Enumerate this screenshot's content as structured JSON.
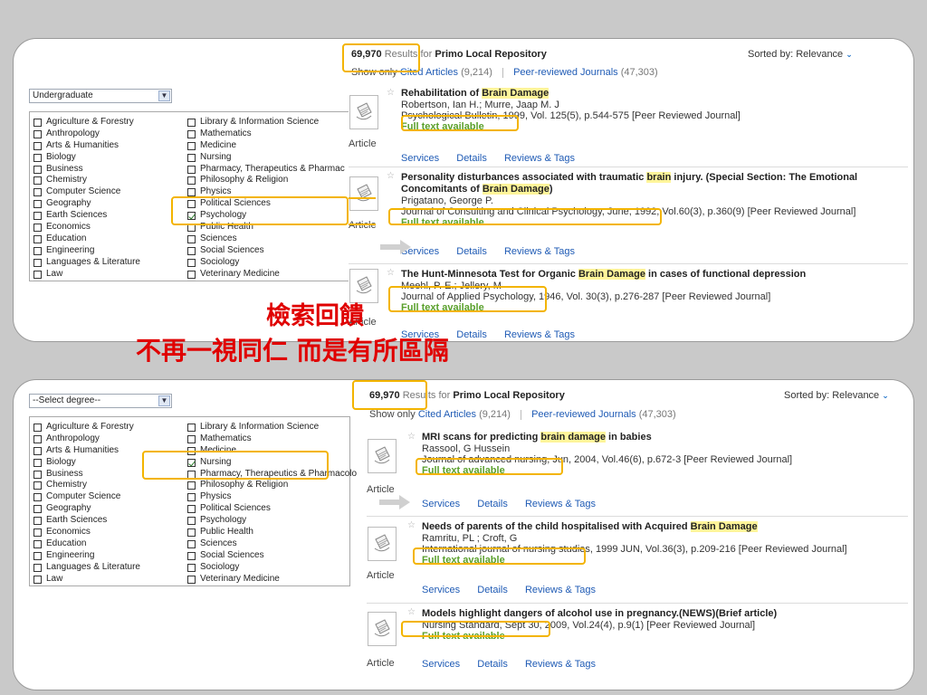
{
  "top_panel": {
    "degree": "Undergraduate",
    "subjects_left": [
      "Agriculture & Forestry",
      "Anthropology",
      "Arts & Humanities",
      "Biology",
      "Business",
      "Chemistry",
      "Computer Science",
      "Geography",
      "Earth Sciences",
      "Economics",
      "Education",
      "Engineering",
      "Languages & Literature",
      "Law"
    ],
    "subjects_right": [
      "Library & Information Science",
      "Mathematics",
      "Medicine",
      "Nursing",
      "Pharmacy, Therapeutics & Pharmac",
      "Philosophy & Religion",
      "Physics",
      "Political Sciences",
      "Psychology",
      "Public Health",
      "Sciences",
      "Social Sciences",
      "Sociology",
      "Veterinary Medicine"
    ],
    "checked_subject": "Psychology",
    "results_count": "69,970",
    "results_text": "Results for",
    "repository": "Primo Local Repository",
    "sorted_label": "Sorted by:",
    "sorted_value": "Relevance",
    "show_only": "Show only",
    "cited_articles": "Cited Articles",
    "cited_count": "(9,214)",
    "peer_reviewed": "Peer-reviewed Journals",
    "peer_count": "(47,303)",
    "records": [
      {
        "title_pre": "Rehabilitation of ",
        "title_hl": "Brain Damage",
        "title_post": "",
        "authors": "Robertson, Ian H.; Murre, Jaap M. J",
        "source": "Psychological Bulletin, 1999, Vol. 125(5), p.544-575 [Peer Reviewed Journal]",
        "fulltext": "Full text available",
        "type": "Article"
      },
      {
        "title_pre": "Personality disturbances associated with traumatic ",
        "title_hl": "brain",
        "title_post": " injury. (Special Section: The Emotional",
        "title_line2_pre": "Concomitants of ",
        "title_line2_hl": "Brain Damage",
        "title_line2_post": ")",
        "authors": "Prigatano, George P.",
        "source": "Journal of Consulting and Clinical Psychology, June, 1992, Vol.60(3), p.360(9) [Peer Reviewed Journal]",
        "fulltext": "Full text available",
        "type": "Article"
      },
      {
        "title_pre": "The Hunt-Minnesota Test for Organic ",
        "title_hl": "Brain Damage",
        "title_post": " in cases of functional depression",
        "authors": "Meehl, P. E.; Jellery, M",
        "source": "Journal of Applied Psychology, 1946, Vol. 30(3), p.276-287 [Peer Reviewed Journal]",
        "fulltext": "Full text available",
        "type": "Article"
      }
    ],
    "links": [
      "Services",
      "Details",
      "Reviews & Tags"
    ]
  },
  "bottom_panel": {
    "degree": "--Select degree--",
    "subjects_left": [
      "Agriculture & Forestry",
      "Anthropology",
      "Arts & Humanities",
      "Biology",
      "Business",
      "Chemistry",
      "Computer Science",
      "Geography",
      "Earth Sciences",
      "Economics",
      "Education",
      "Engineering",
      "Languages & Literature",
      "Law"
    ],
    "subjects_right": [
      "Library & Information Science",
      "Mathematics",
      "Medicine",
      "Nursing",
      "Pharmacy, Therapeutics & Pharmacolo",
      "Philosophy & Religion",
      "Physics",
      "Political Sciences",
      "Psychology",
      "Public Health",
      "Sciences",
      "Social Sciences",
      "Sociology",
      "Veterinary Medicine"
    ],
    "checked_subject": "Nursing",
    "results_count": "69,970",
    "results_text": "Results for",
    "repository": "Primo Local Repository",
    "sorted_label": "Sorted by:",
    "sorted_value": "Relevance",
    "show_only": "Show only",
    "cited_articles": "Cited Articles",
    "cited_count": "(9,214)",
    "peer_reviewed": "Peer-reviewed Journals",
    "peer_count": "(47,303)",
    "records": [
      {
        "title_pre": "MRI scans for predicting ",
        "title_hl": "brain damage",
        "title_post": " in babies",
        "authors": "Rassool, G Hussein",
        "source": "Journal of advanced nursing, Jun, 2004, Vol.46(6), p.672-3 [Peer Reviewed Journal]",
        "fulltext": "Full text available",
        "type": "Article"
      },
      {
        "title_pre": "Needs of parents of the child hospitalised with Acquired ",
        "title_hl": "Brain Damage",
        "title_post": "",
        "authors": "Ramritu, PL ; Croft, G",
        "source": "International journal of nursing studies, 1999 JUN, Vol.36(3), p.209-216 [Peer Reviewed Journal]",
        "fulltext": "Full text available",
        "type": "Article"
      },
      {
        "title_pre": "Models highlight dangers of alcohol use in pregnancy.(NEWS)(Brief article)",
        "title_hl": "",
        "title_post": "",
        "authors": "",
        "source": "Nursing Standard, Sept 30, 2009, Vol.24(4), p.9(1) [Peer Reviewed Journal]",
        "fulltext": "Full text available",
        "type": "Article"
      }
    ],
    "links": [
      "Services",
      "Details",
      "Reviews & Tags"
    ]
  },
  "annotation": {
    "line1": "檢索回饋",
    "line2": "不再一視同仁 而是有所區隔",
    "color": "#e00000"
  },
  "colors": {
    "highlight_box": "#f3b400",
    "fulltext": "#5aa02c",
    "link": "#1f5bb5",
    "keyword_bg": "#fff59a"
  },
  "icons": {
    "document": "document-icon",
    "star": "star-icon",
    "checkbox": "checkbox-icon",
    "arrow": "gray-arrow-icon",
    "chevron": "chevron-down-icon"
  }
}
